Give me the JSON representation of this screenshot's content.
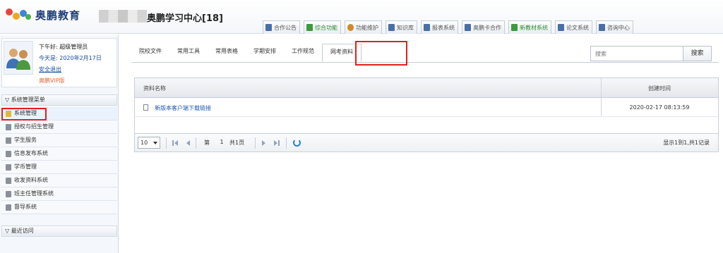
{
  "header": {
    "brand": "奥鹏教育",
    "site_title": "奥鹏学习中心[18]",
    "nav": [
      {
        "label": "合作公告",
        "icon": "notice-icon",
        "green": false
      },
      {
        "label": "综合功能",
        "icon": "chart-icon",
        "green": true
      },
      {
        "label": "功能维护",
        "icon": "user-icon",
        "green": false
      },
      {
        "label": "知识库",
        "icon": "book-icon",
        "green": false
      },
      {
        "label": "报表系统",
        "icon": "report-icon",
        "green": false
      },
      {
        "label": "奥鹏卡合作",
        "icon": "card-icon",
        "green": false
      },
      {
        "label": "新教材系统",
        "icon": "book-green-icon",
        "green": true
      },
      {
        "label": "论文系统",
        "icon": "paper-icon",
        "green": false
      },
      {
        "label": "咨询中心",
        "icon": "help-icon",
        "green": false
      }
    ]
  },
  "user": {
    "greeting": "下午好: 超级管理员",
    "date": "今天是: 2020年2月17日",
    "logout": "安全退出",
    "vip": "奥鹏VIP版"
  },
  "sidebar": {
    "panel_title": "系统管理菜单",
    "items": [
      {
        "label": "系统管理",
        "active": true
      },
      {
        "label": "授权与招生管理",
        "active": false
      },
      {
        "label": "学生服务",
        "active": false
      },
      {
        "label": "信息发布系统",
        "active": false
      },
      {
        "label": "学币管理",
        "active": false
      },
      {
        "label": "收发资料系统",
        "active": false
      },
      {
        "label": "班主任管理系统",
        "active": false
      },
      {
        "label": "督导系统",
        "active": false
      }
    ],
    "recent_title": "最近访问"
  },
  "tabs": [
    {
      "label": "院校文件",
      "active": false
    },
    {
      "label": "常用工具",
      "active": false
    },
    {
      "label": "常用表格",
      "active": false
    },
    {
      "label": "学期安排",
      "active": false
    },
    {
      "label": "工作规范",
      "active": false
    },
    {
      "label": "网考资料",
      "active": true
    }
  ],
  "search": {
    "placeholder": "搜索",
    "button": "搜索"
  },
  "grid": {
    "columns": [
      "资料名称",
      "创建时间"
    ],
    "rows": [
      {
        "name": "新版本客户端下载链接",
        "time": "2020-02-17 08:13:59"
      }
    ]
  },
  "pager": {
    "page_size": "10",
    "page_prefix": "第",
    "page": "1",
    "page_suffix": "共1页",
    "summary": "显示1到1,共1记录"
  },
  "colors": {
    "highlight": "#e02020",
    "link": "#1a56b0",
    "accent": "#2b7fd6"
  }
}
